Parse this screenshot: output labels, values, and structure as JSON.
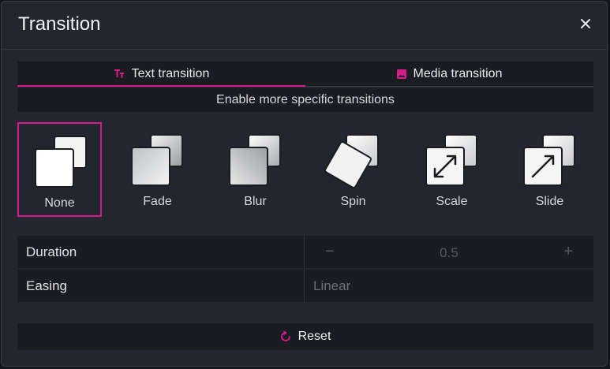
{
  "dialog": {
    "title": "Transition"
  },
  "tabs": [
    {
      "label": "Text transition",
      "icon": "text-type-icon",
      "active": true
    },
    {
      "label": "Media transition",
      "icon": "image-icon",
      "active": false
    }
  ],
  "subtitle": "Enable more specific transitions",
  "options": [
    {
      "label": "None",
      "icon": "none-transition-icon",
      "selected": true
    },
    {
      "label": "Fade",
      "icon": "fade-transition-icon",
      "selected": false
    },
    {
      "label": "Blur",
      "icon": "blur-transition-icon",
      "selected": false
    },
    {
      "label": "Spin",
      "icon": "spin-transition-icon",
      "selected": false
    },
    {
      "label": "Scale",
      "icon": "scale-transition-icon",
      "selected": false
    },
    {
      "label": "Slide",
      "icon": "slide-transition-icon",
      "selected": false
    }
  ],
  "settings": {
    "duration": {
      "label": "Duration",
      "value": "0.5",
      "minus": "−",
      "plus": "+"
    },
    "easing": {
      "label": "Easing",
      "value": "Linear"
    }
  },
  "reset_label": "Reset",
  "colors": {
    "accent": "#d81b8a",
    "panel": "#23262e",
    "row": "#1a1c21"
  }
}
